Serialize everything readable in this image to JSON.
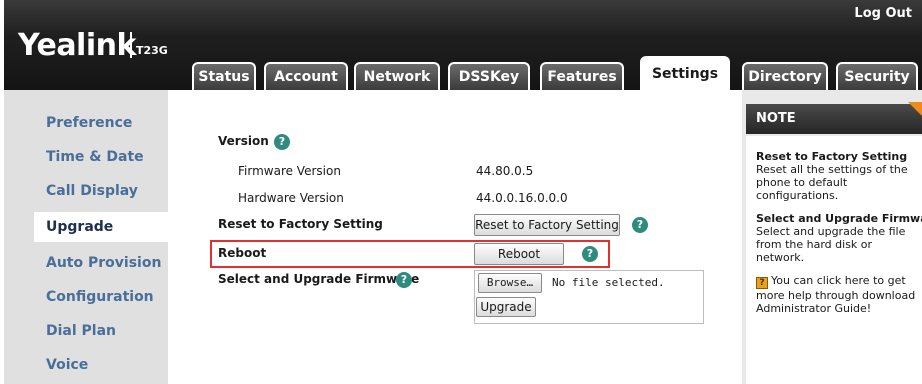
{
  "brand": {
    "logo": "Yealink",
    "model": "T23G"
  },
  "header": {
    "logout": "Log Out"
  },
  "tabs": [
    {
      "label": "Status",
      "active": false
    },
    {
      "label": "Account",
      "active": false
    },
    {
      "label": "Network",
      "active": false
    },
    {
      "label": "DSSKey",
      "active": false
    },
    {
      "label": "Features",
      "active": false
    },
    {
      "label": "Settings",
      "active": true
    },
    {
      "label": "Directory",
      "active": false
    },
    {
      "label": "Security",
      "active": false
    }
  ],
  "sidebar": {
    "items": [
      {
        "label": "Preference",
        "active": false
      },
      {
        "label": "Time & Date",
        "active": false
      },
      {
        "label": "Call Display",
        "active": false
      },
      {
        "label": "Upgrade",
        "active": true
      },
      {
        "label": "Auto Provision",
        "active": false
      },
      {
        "label": "Configuration",
        "active": false
      },
      {
        "label": "Dial Plan",
        "active": false
      },
      {
        "label": "Voice",
        "active": false
      }
    ]
  },
  "main": {
    "version_label": "Version",
    "firmware_label": "Firmware Version",
    "firmware_value": "44.80.0.5",
    "hardware_label": "Hardware Version",
    "hardware_value": "44.0.0.16.0.0.0",
    "reset_label": "Reset to Factory Setting",
    "reset_button": "Reset to Factory Setting",
    "reboot_label": "Reboot",
    "reboot_button": "Reboot",
    "upgrade_label": "Select and Upgrade Firmware",
    "browse_button": "Browse…",
    "file_status": "No file selected.",
    "upgrade_button": "Upgrade",
    "help_glyph": "?"
  },
  "note": {
    "title": "NOTE",
    "sections": [
      {
        "title": "Reset to Factory Setting",
        "text": "Reset all the settings of the phone to default configurations."
      },
      {
        "title": "Select and Upgrade Firmware",
        "text": "Select and upgrade the file from the hard disk or network."
      }
    ],
    "help_text": "You can click here to get more help through download Administrator Guide!",
    "help_icon_glyph": "?"
  },
  "colors": {
    "highlight_border": "#e03030",
    "help_icon": "#2e8b7e",
    "note_corner": "#f08a1c",
    "sidebar_link": "#4a6e9a"
  }
}
